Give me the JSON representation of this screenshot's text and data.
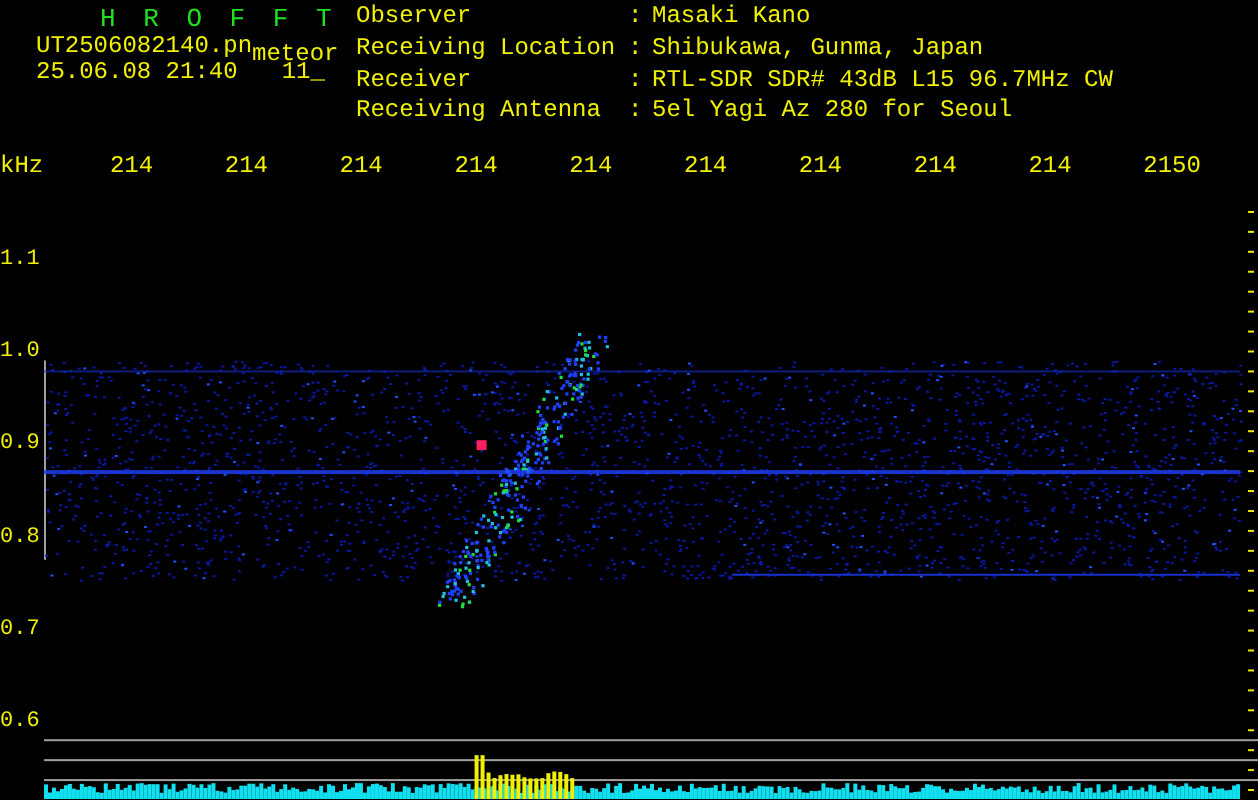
{
  "title": "H R O F F T",
  "file_name": "UT2506082140.pn",
  "tag": "meteor",
  "timestamp": "25.06.08 21:40",
  "counter": "11_",
  "info": [
    {
      "label": "Observer",
      "separator": ":",
      "value": "Masaki Kano"
    },
    {
      "label": "Receiving Location",
      "separator": ":",
      "value": "Shibukawa, Gunma, Japan"
    },
    {
      "label": "Receiver",
      "separator": ":",
      "value": "RTL-SDR SDR# 43dB L15 96.7MHz CW"
    },
    {
      "label": "Receiving Antenna",
      "separator": ":",
      "value": "5el Yagi Az 280 for Seoul"
    }
  ],
  "frequency_axis": {
    "unit": "kHz",
    "ticks": [
      "214",
      "214",
      "214",
      "214",
      "214",
      "214",
      "214",
      "214",
      "214",
      "2150"
    ]
  },
  "vertical_axis": {
    "ticks": [
      "1.1",
      "1.0",
      "0.9",
      "0.8",
      "0.7",
      "0.6"
    ]
  }
}
